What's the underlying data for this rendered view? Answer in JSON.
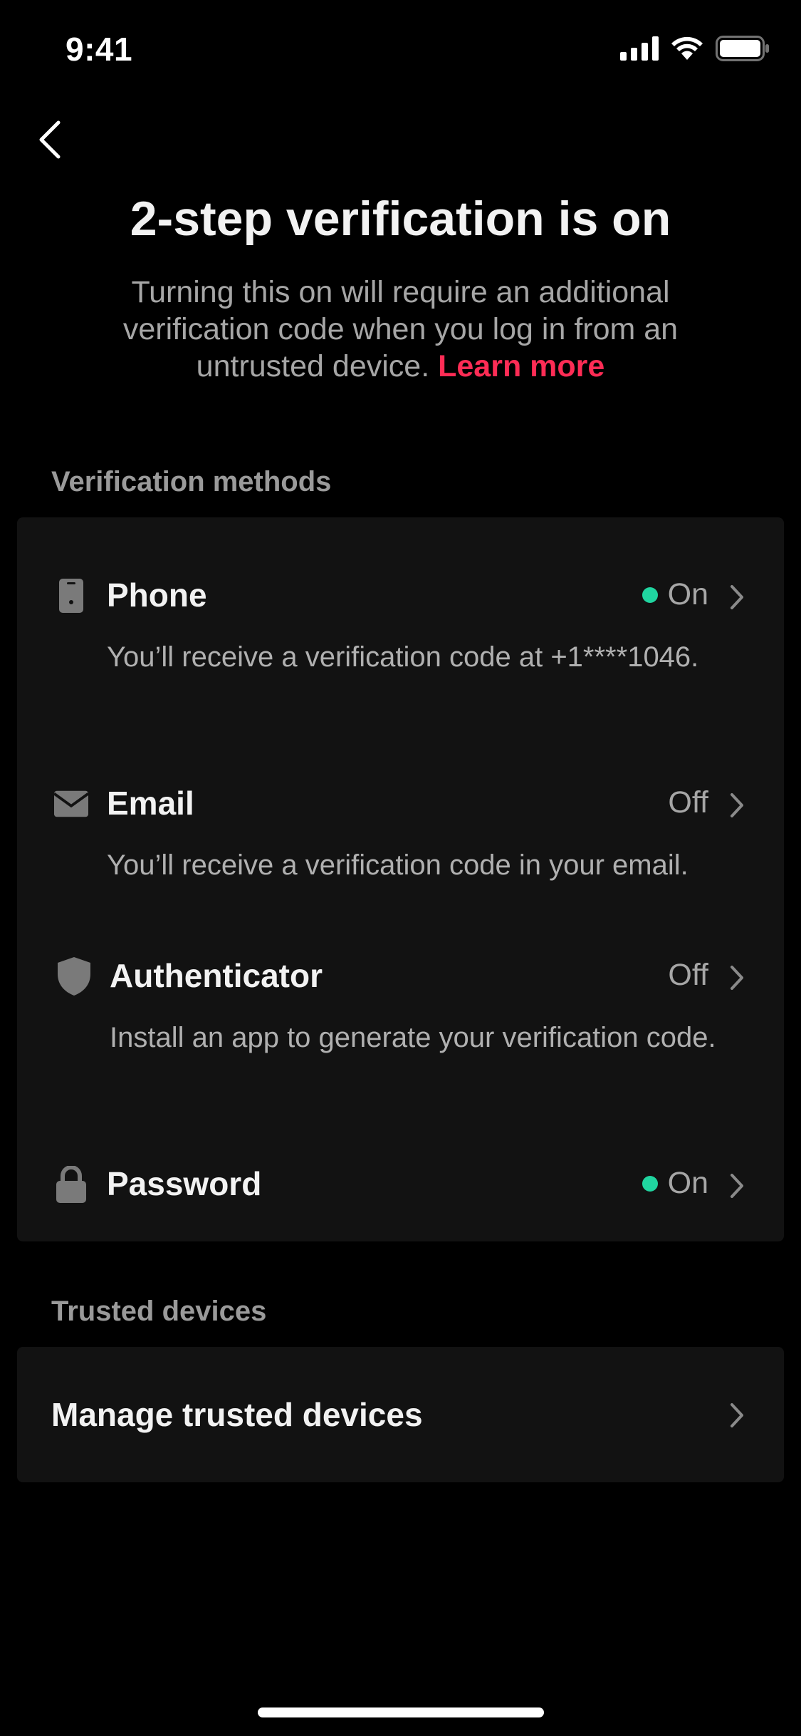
{
  "status_bar": {
    "time": "9:41",
    "icons": [
      "signal-icon",
      "wifi-icon",
      "battery-icon"
    ]
  },
  "header": {
    "back_icon": "chevron-left-icon",
    "title": "2-step verification is on",
    "description": "Turning this on will require an additional verification code when you log in from an untrusted device.",
    "learn_more": "Learn more"
  },
  "verification_methods": {
    "label": "Verification methods",
    "items": [
      {
        "name": "Phone",
        "icon": "phone-icon",
        "status": "On",
        "enabled": true,
        "description": "You’ll receive a verification code at +1****1046."
      },
      {
        "name": "Email",
        "icon": "envelope-icon",
        "status": "Off",
        "enabled": false,
        "description": "You’ll receive a verification code in your email."
      },
      {
        "name": "Authenticator",
        "icon": "shield-icon",
        "status": "Off",
        "enabled": false,
        "description": "Install an app to generate your verification code."
      },
      {
        "name": "Password",
        "icon": "lock-icon",
        "status": "On",
        "enabled": true,
        "description": ""
      }
    ]
  },
  "trusted_devices": {
    "label": "Trusted devices",
    "manage_label": "Manage trusted devices"
  },
  "colors": {
    "background": "#000000",
    "card": "#121212",
    "accent": "#fe2c55",
    "status_on": "#20d5a0",
    "secondary_text": "#a6a6a6"
  }
}
